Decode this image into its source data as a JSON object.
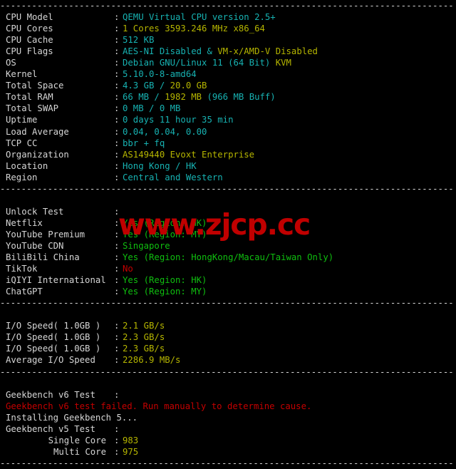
{
  "terminal": {
    "separator": "----------------------------------------------------------------------",
    "watermark": "www.zjcp.cc",
    "sections": [
      {
        "name": "system-info",
        "rows": [
          {
            "label": "CPU Model",
            "parts": [
              {
                "text": "QEMU Virtual CPU version 2.5+",
                "color": "cyan"
              }
            ]
          },
          {
            "label": "CPU Cores",
            "parts": [
              {
                "text": "1 Cores 3593.246 MHz x86_64",
                "color": "yellow"
              }
            ]
          },
          {
            "label": "CPU Cache",
            "parts": [
              {
                "text": "512 KB",
                "color": "cyan"
              }
            ]
          },
          {
            "label": "CPU Flags",
            "parts": [
              {
                "text": "AES-NI Disabled & ",
                "color": "cyan"
              },
              {
                "text": "VM-x/AMD-V Disabled",
                "color": "yellow"
              }
            ]
          },
          {
            "label": "OS",
            "parts": [
              {
                "text": "Debian GNU/Linux 11 (64 Bit) ",
                "color": "cyan"
              },
              {
                "text": "KVM",
                "color": "yellow"
              }
            ]
          },
          {
            "label": "Kernel",
            "parts": [
              {
                "text": "5.10.0-8-amd64",
                "color": "cyan"
              }
            ]
          },
          {
            "label": "Total Space",
            "parts": [
              {
                "text": "4.3 GB / ",
                "color": "cyan"
              },
              {
                "text": "20.0 GB",
                "color": "yellow"
              }
            ]
          },
          {
            "label": "Total RAM",
            "parts": [
              {
                "text": "66 MB / ",
                "color": "cyan"
              },
              {
                "text": "1982 MB ",
                "color": "yellow"
              },
              {
                "text": "(966 MB Buff)",
                "color": "cyan"
              }
            ]
          },
          {
            "label": "Total SWAP",
            "parts": [
              {
                "text": "0 MB / 0 MB",
                "color": "cyan"
              }
            ]
          },
          {
            "label": "Uptime",
            "parts": [
              {
                "text": "0 days 11 hour 35 min",
                "color": "cyan"
              }
            ]
          },
          {
            "label": "Load Average",
            "parts": [
              {
                "text": "0.04, 0.04, 0.00",
                "color": "cyan"
              }
            ]
          },
          {
            "label": "TCP CC",
            "parts": [
              {
                "text": "bbr + fq",
                "color": "cyan"
              }
            ]
          },
          {
            "label": "Organization",
            "parts": [
              {
                "text": "AS149440 Evoxt Enterprise",
                "color": "yellow"
              }
            ]
          },
          {
            "label": "Location",
            "parts": [
              {
                "text": "Hong Kong / HK",
                "color": "cyan"
              }
            ]
          },
          {
            "label": "Region",
            "parts": [
              {
                "text": "Central and Western",
                "color": "cyan"
              }
            ]
          }
        ]
      },
      {
        "name": "unlock-test",
        "rows": [
          {
            "label": "Unlock Test",
            "parts": []
          },
          {
            "label": "Netflix",
            "parts": [
              {
                "text": "Yes (Region: HK)",
                "color": "green"
              }
            ]
          },
          {
            "label": "YouTube Premium",
            "parts": [
              {
                "text": "Yes (Region: MY)",
                "color": "green"
              }
            ]
          },
          {
            "label": "YouTube CDN",
            "parts": [
              {
                "text": "Singapore",
                "color": "green"
              }
            ]
          },
          {
            "label": "BiliBili China",
            "parts": [
              {
                "text": "Yes (Region: HongKong/Macau/Taiwan Only)",
                "color": "green"
              }
            ]
          },
          {
            "label": "TikTok",
            "parts": [
              {
                "text": "No",
                "color": "red"
              }
            ]
          },
          {
            "label": "iQIYI International",
            "parts": [
              {
                "text": "Yes (Region: HK)",
                "color": "green"
              }
            ]
          },
          {
            "label": "ChatGPT",
            "parts": [
              {
                "text": "Yes (Region: MY)",
                "color": "green"
              }
            ]
          }
        ]
      },
      {
        "name": "io-speed",
        "rows": [
          {
            "label": "I/O Speed( 1.0GB )",
            "parts": [
              {
                "text": "2.1 GB/s",
                "color": "yellow"
              }
            ]
          },
          {
            "label": "I/O Speed( 1.0GB )",
            "parts": [
              {
                "text": "2.3 GB/s",
                "color": "yellow"
              }
            ]
          },
          {
            "label": "I/O Speed( 1.0GB )",
            "parts": [
              {
                "text": "2.3 GB/s",
                "color": "yellow"
              }
            ]
          },
          {
            "label": "Average I/O Speed",
            "parts": [
              {
                "text": "2286.9 MB/s",
                "color": "yellow"
              }
            ]
          }
        ]
      },
      {
        "name": "geekbench",
        "rows": [
          {
            "label": "Geekbench v6 Test",
            "parts": []
          },
          {
            "free": "Geekbench v6 test failed. Run manually to determine cause.",
            "color": "red"
          },
          {
            "free": "Installing Geekbench 5...",
            "color": "white"
          },
          {
            "label": "Geekbench v5 Test",
            "parts": []
          },
          {
            "label": "Single Core",
            "indent": true,
            "parts": [
              {
                "text": "983",
                "color": "yellow"
              }
            ]
          },
          {
            "label": "Multi Core",
            "indent": true,
            "parts": [
              {
                "text": "975",
                "color": "yellow"
              }
            ]
          }
        ]
      }
    ]
  }
}
